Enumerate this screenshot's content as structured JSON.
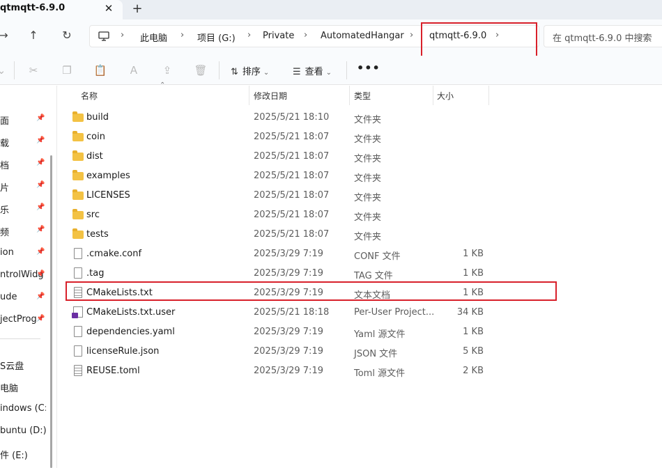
{
  "window": {
    "tab_title": "qtmqtt-6.9.0",
    "tab_close": "✕",
    "tab_add": "+"
  },
  "nav": {
    "back": "→",
    "up": "↑",
    "refresh": "↻"
  },
  "breadcrumb": [
    {
      "label": "此电脑"
    },
    {
      "label": "项目 (G:)"
    },
    {
      "label": "Private"
    },
    {
      "label": "AutomatedHangar"
    },
    {
      "label": "qtmqtt-6.9.0"
    }
  ],
  "search": {
    "placeholder": "在 qtmqtt-6.9.0 中搜索"
  },
  "toolbar": {
    "sort_label": "排序",
    "view_label": "查看",
    "more_label": "•••",
    "icons": [
      "cut-icon",
      "copy-icon",
      "paste-icon",
      "rename-icon",
      "share-icon",
      "delete-icon"
    ]
  },
  "sidebar": {
    "items": [
      {
        "label": "面",
        "pinned": true
      },
      {
        "label": "载",
        "pinned": true
      },
      {
        "label": "档",
        "pinned": true
      },
      {
        "label": "片",
        "pinned": true
      },
      {
        "label": "乐",
        "pinned": true
      },
      {
        "label": "频",
        "pinned": true
      },
      {
        "label": "ion",
        "pinned": true
      },
      {
        "label": "ntrolWidg",
        "pinned": true
      },
      {
        "label": "ude",
        "pinned": true
      },
      {
        "label": "jectProg",
        "pinned": true
      }
    ],
    "drives": [
      {
        "label": "S云盘"
      },
      {
        "label": "电脑"
      },
      {
        "label": "indows (C:)"
      },
      {
        "label": "buntu (D:)"
      },
      {
        "label": "件 (E:)"
      }
    ]
  },
  "columns": {
    "name": "名称",
    "date": "修改日期",
    "type": "类型",
    "size": "大小"
  },
  "files": [
    {
      "name": "build",
      "date": "2025/5/21 18:10",
      "type": "文件夹",
      "size": "",
      "icon": "folder-icon"
    },
    {
      "name": "coin",
      "date": "2025/5/21 18:07",
      "type": "文件夹",
      "size": "",
      "icon": "folder-icon"
    },
    {
      "name": "dist",
      "date": "2025/5/21 18:07",
      "type": "文件夹",
      "size": "",
      "icon": "folder-icon"
    },
    {
      "name": "examples",
      "date": "2025/5/21 18:07",
      "type": "文件夹",
      "size": "",
      "icon": "folder-icon"
    },
    {
      "name": "LICENSES",
      "date": "2025/5/21 18:07",
      "type": "文件夹",
      "size": "",
      "icon": "folder-icon"
    },
    {
      "name": "src",
      "date": "2025/5/21 18:07",
      "type": "文件夹",
      "size": "",
      "icon": "folder-icon"
    },
    {
      "name": "tests",
      "date": "2025/5/21 18:07",
      "type": "文件夹",
      "size": "",
      "icon": "folder-icon"
    },
    {
      "name": ".cmake.conf",
      "date": "2025/3/29 7:19",
      "type": "CONF 文件",
      "size": "1 KB",
      "icon": "file-icon"
    },
    {
      "name": ".tag",
      "date": "2025/3/29 7:19",
      "type": "TAG 文件",
      "size": "1 KB",
      "icon": "file-icon"
    },
    {
      "name": "CMakeLists.txt",
      "date": "2025/3/29 7:19",
      "type": "文本文档",
      "size": "1 KB",
      "icon": "text-file-icon"
    },
    {
      "name": "CMakeLists.txt.user",
      "date": "2025/5/21 18:18",
      "type": "Per-User Project...",
      "size": "34 KB",
      "icon": "qt-project-icon"
    },
    {
      "name": "dependencies.yaml",
      "date": "2025/3/29 7:19",
      "type": "Yaml 源文件",
      "size": "1 KB",
      "icon": "file-icon"
    },
    {
      "name": "licenseRule.json",
      "date": "2025/3/29 7:19",
      "type": "JSON 文件",
      "size": "5 KB",
      "icon": "file-icon"
    },
    {
      "name": "REUSE.toml",
      "date": "2025/3/29 7:19",
      "type": "Toml 源文件",
      "size": "2 KB",
      "icon": "text-file-icon"
    }
  ],
  "colors": {
    "highlight": "#d8202a",
    "folder": "#f3c244"
  }
}
